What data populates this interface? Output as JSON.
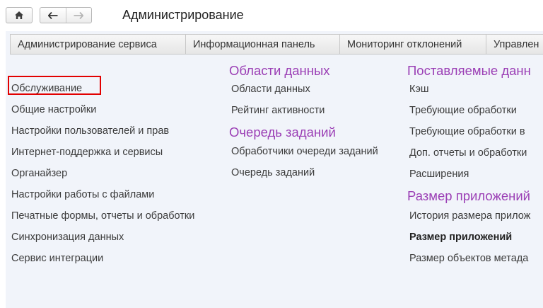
{
  "header": {
    "title": "Администрирование"
  },
  "tabs": [
    {
      "label": "Администрирование сервиса"
    },
    {
      "label": "Информационная панель"
    },
    {
      "label": "Мониторинг отклонений"
    },
    {
      "label": "Управлен"
    }
  ],
  "col1": {
    "items": [
      {
        "label": "Обслуживание"
      },
      {
        "label": "Общие настройки"
      },
      {
        "label": "Настройки пользователей и прав"
      },
      {
        "label": "Интернет-поддержка и сервисы"
      },
      {
        "label": "Органайзер"
      },
      {
        "label": "Настройки работы с файлами"
      },
      {
        "label": "Печатные формы, отчеты и обработки"
      },
      {
        "label": "Синхронизация данных"
      },
      {
        "label": "Сервис интеграции"
      }
    ]
  },
  "col2": {
    "group1_title": "Области данных",
    "group1_items": [
      {
        "label": "Области данных"
      },
      {
        "label": "Рейтинг активности"
      }
    ],
    "group2_title": "Очередь заданий",
    "group2_items": [
      {
        "label": "Обработчики очереди заданий"
      },
      {
        "label": "Очередь заданий"
      }
    ]
  },
  "col3": {
    "group1_title": "Поставляемые данн",
    "group1_items": [
      {
        "label": "Кэш"
      },
      {
        "label": "Требующие обработки"
      },
      {
        "label": "Требующие обработки в"
      },
      {
        "label": "Доп. отчеты и обработки"
      },
      {
        "label": "Расширения"
      }
    ],
    "group2_title": "Размер приложений",
    "group2_items": [
      {
        "label": "История размера прилож"
      },
      {
        "label": "Размер приложений"
      },
      {
        "label": "Размер объектов метада"
      }
    ]
  },
  "icons": {
    "home": "home-icon",
    "back": "arrow-left-icon",
    "forward": "arrow-right-icon"
  }
}
